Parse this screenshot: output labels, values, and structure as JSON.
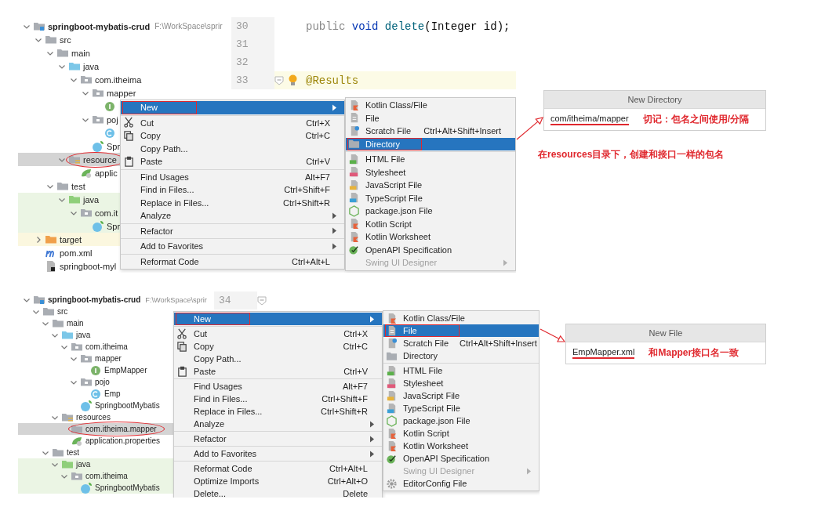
{
  "panels": [
    {
      "tree": {
        "nodes": [
          {
            "label": "springboot-mybatis-crud",
            "path": "F:\\WorkSpace\\sprir",
            "kind": "module",
            "expanded": true,
            "selected": false,
            "children": [
              {
                "label": "src",
                "kind": "folder",
                "expanded": true,
                "selected": false,
                "children": [
                  {
                    "label": "main",
                    "kind": "folder",
                    "expanded": true,
                    "selected": false,
                    "children": [
                      {
                        "label": "java",
                        "kind": "source",
                        "expanded": true,
                        "selected": false,
                        "children": [
                          {
                            "label": "com.itheima",
                            "kind": "package",
                            "expanded": true,
                            "selected": false,
                            "children": [
                              {
                                "label": "mapper",
                                "kind": "package",
                                "expanded": true,
                                "selected": false,
                                "children": [
                                  {
                                    "kind": "interface",
                                    "selected": false
                                  }
                                ]
                              },
                              {
                                "label": "poj",
                                "kind": "package",
                                "expanded": true,
                                "selected": false,
                                "children": [
                                  {
                                    "kind": "class",
                                    "selected": false
                                  }
                                ]
                              },
                              {
                                "label": "Spr",
                                "kind": "springclass",
                                "selected": false
                              }
                            ]
                          }
                        ]
                      },
                      {
                        "label": "resource",
                        "kind": "resources",
                        "expanded": true,
                        "selected": true,
                        "circled": true,
                        "children": [
                          {
                            "label": "applic",
                            "kind": "props",
                            "selected": false
                          }
                        ]
                      }
                    ]
                  },
                  {
                    "label": "test",
                    "kind": "folder",
                    "expanded": true,
                    "selected": false,
                    "children": [
                      {
                        "label": "java",
                        "kind": "testsource",
                        "test": true,
                        "expanded": true,
                        "selected": false,
                        "children": [
                          {
                            "label": "com.it",
                            "kind": "package",
                            "expanded": true,
                            "selected": false,
                            "children": [
                              {
                                "label": "Spr",
                                "kind": "springclass",
                                "selected": false
                              }
                            ]
                          }
                        ]
                      }
                    ]
                  }
                ]
              },
              {
                "label": "target",
                "kind": "target",
                "excluded": true,
                "expanded": false,
                "selected": false
              },
              {
                "label": "pom.xml",
                "kind": "maven",
                "selected": false
              },
              {
                "label": "springboot-myl",
                "kind": "iml",
                "selected": false
              }
            ]
          }
        ]
      },
      "editor": {
        "lines": [
          {
            "number": "30",
            "current": false,
            "hint": false,
            "fold": false,
            "tokens": [
              {
                "text": "public ",
                "kind": "modifier"
              },
              {
                "text": "void ",
                "kind": "keyword"
              },
              {
                "text": "delete",
                "kind": "method"
              },
              {
                "text": "(Integer id);",
                "kind": "plain"
              }
            ]
          },
          {
            "number": "31",
            "current": false,
            "hint": false,
            "fold": false
          },
          {
            "number": "32",
            "current": false,
            "hint": false,
            "fold": false
          },
          {
            "number": "33",
            "current": true,
            "hint": true,
            "fold": true,
            "tokens": [
              {
                "text": "@Results",
                "kind": "annotation"
              }
            ]
          }
        ]
      },
      "menu": {
        "groups": [
          [
            {
              "label": "New",
              "submenu": true,
              "selected": true,
              "annotated": true
            }
          ],
          [
            {
              "label": "Cut",
              "shortcut": "Ctrl+X",
              "kind": "scissors",
              "selected": false
            },
            {
              "label": "Copy",
              "shortcut": "Ctrl+C",
              "kind": "copy",
              "selected": false
            },
            {
              "label": "Copy Path...",
              "selected": false
            },
            {
              "label": "Paste",
              "shortcut": "Ctrl+V",
              "kind": "paste",
              "selected": false
            }
          ],
          [
            {
              "label": "Find Usages",
              "shortcut": "Alt+F7",
              "selected": false
            },
            {
              "label": "Find in Files...",
              "shortcut": "Ctrl+Shift+F",
              "selected": false
            },
            {
              "label": "Replace in Files...",
              "shortcut": "Ctrl+Shift+R",
              "selected": false
            },
            {
              "label": "Analyze",
              "submenu": true,
              "selected": false
            }
          ],
          [
            {
              "label": "Refactor",
              "submenu": true,
              "selected": false
            }
          ],
          [
            {
              "label": "Add to Favorites",
              "submenu": true,
              "selected": false
            }
          ],
          [
            {
              "label": "Reformat Code",
              "shortcut": "Ctrl+Alt+L",
              "selected": false
            }
          ]
        ]
      },
      "submenu": {
        "groups": [
          [
            {
              "label": "Kotlin Class/File",
              "kind": "kotlin",
              "selected": false
            },
            {
              "label": "File",
              "kind": "file",
              "selected": false
            },
            {
              "label": "Scratch File",
              "shortcut": "Ctrl+Alt+Shift+Insert",
              "kind": "scratch",
              "selected": false
            },
            {
              "label": "Directory",
              "kind": "folder",
              "selected": true,
              "annotated": true
            }
          ],
          [
            {
              "label": "HTML File",
              "kind": "html",
              "selected": false
            },
            {
              "label": "Stylesheet",
              "kind": "css",
              "selected": false
            },
            {
              "label": "JavaScript File",
              "kind": "js",
              "selected": false
            },
            {
              "label": "TypeScript File",
              "kind": "ts",
              "selected": false
            },
            {
              "label": "package.json File",
              "kind": "nodejs",
              "selected": false
            },
            {
              "label": "Kotlin Script",
              "kind": "kotlin",
              "selected": false
            },
            {
              "label": "Kotlin Worksheet",
              "kind": "kotlin",
              "selected": false
            },
            {
              "label": "OpenAPI Specification",
              "kind": "openapi",
              "selected": false
            },
            {
              "label": "Swing UI Designer",
              "submenu": true,
              "disabled": true,
              "selected": false
            }
          ]
        ]
      },
      "dialog": {
        "title": "New Directory",
        "value": "com/itheima/mapper",
        "note": "切记：包名之间使用/分隔"
      },
      "caption": "在resources目录下，创建和接口一样的包名"
    },
    {
      "tree": {
        "nodes": [
          {
            "label": "springboot-mybatis-crud",
            "path": "F:\\WorkSpace\\sprir",
            "kind": "module",
            "expanded": true,
            "selected": false,
            "children": [
              {
                "label": "src",
                "kind": "folder",
                "expanded": true,
                "selected": false,
                "children": [
                  {
                    "label": "main",
                    "kind": "folder",
                    "expanded": true,
                    "selected": false,
                    "children": [
                      {
                        "label": "java",
                        "kind": "source",
                        "expanded": true,
                        "selected": false,
                        "children": [
                          {
                            "label": "com.itheima",
                            "kind": "package",
                            "expanded": true,
                            "selected": false,
                            "children": [
                              {
                                "label": "mapper",
                                "kind": "package",
                                "expanded": true,
                                "selected": false,
                                "children": [
                                  {
                                    "label": "EmpMapper",
                                    "kind": "interface",
                                    "selected": false
                                  }
                                ]
                              },
                              {
                                "label": "pojo",
                                "kind": "package",
                                "expanded": true,
                                "selected": false,
                                "children": [
                                  {
                                    "label": "Emp",
                                    "kind": "class",
                                    "selected": false
                                  }
                                ]
                              },
                              {
                                "label": "SpringbootMybatis",
                                "kind": "springclass",
                                "selected": false
                              }
                            ]
                          }
                        ]
                      },
                      {
                        "label": "resources",
                        "kind": "resources",
                        "expanded": true,
                        "selected": false,
                        "children": [
                          {
                            "label": "com.itheima.mapper",
                            "kind": "folder",
                            "selected": true,
                            "circled": true
                          },
                          {
                            "label": "application.properties",
                            "kind": "props",
                            "selected": false
                          }
                        ]
                      }
                    ]
                  },
                  {
                    "label": "test",
                    "kind": "folder",
                    "expanded": true,
                    "selected": false,
                    "children": [
                      {
                        "label": "java",
                        "kind": "testsource",
                        "test": true,
                        "expanded": true,
                        "selected": false,
                        "children": [
                          {
                            "label": "com.itheima",
                            "kind": "package",
                            "expanded": true,
                            "selected": false,
                            "children": [
                              {
                                "label": "SpringbootMybatis",
                                "kind": "springclass",
                                "selected": false
                              }
                            ]
                          }
                        ]
                      }
                    ]
                  }
                ]
              }
            ]
          }
        ]
      },
      "editor": {
        "lines": [
          {
            "number": "34",
            "current": false,
            "hint": false,
            "fold": true
          }
        ]
      },
      "menu": {
        "groups": [
          [
            {
              "label": "New",
              "submenu": true,
              "selected": true,
              "annotated": true
            }
          ],
          [
            {
              "label": "Cut",
              "shortcut": "Ctrl+X",
              "kind": "scissors",
              "selected": false
            },
            {
              "label": "Copy",
              "shortcut": "Ctrl+C",
              "kind": "copy",
              "selected": false
            },
            {
              "label": "Copy Path...",
              "selected": false
            },
            {
              "label": "Paste",
              "shortcut": "Ctrl+V",
              "kind": "paste",
              "selected": false
            }
          ],
          [
            {
              "label": "Find Usages",
              "shortcut": "Alt+F7",
              "selected": false
            },
            {
              "label": "Find in Files...",
              "shortcut": "Ctrl+Shift+F",
              "selected": false
            },
            {
              "label": "Replace in Files...",
              "shortcut": "Ctrl+Shift+R",
              "selected": false
            },
            {
              "label": "Analyze",
              "submenu": true,
              "selected": false
            }
          ],
          [
            {
              "label": "Refactor",
              "submenu": true,
              "selected": false
            }
          ],
          [
            {
              "label": "Add to Favorites",
              "submenu": true,
              "selected": false
            }
          ],
          [
            {
              "label": "Reformat Code",
              "shortcut": "Ctrl+Alt+L",
              "selected": false
            },
            {
              "label": "Optimize Imports",
              "shortcut": "Ctrl+Alt+O",
              "selected": false
            },
            {
              "label": "Delete...",
              "shortcut": "Delete",
              "selected": false
            }
          ]
        ]
      },
      "submenu": {
        "groups": [
          [
            {
              "label": "Kotlin Class/File",
              "kind": "kotlin",
              "selected": false
            },
            {
              "label": "File",
              "kind": "file",
              "selected": true,
              "annotated": true
            },
            {
              "label": "Scratch File",
              "shortcut": "Ctrl+Alt+Shift+Insert",
              "kind": "scratch",
              "selected": false
            },
            {
              "label": "Directory",
              "kind": "folder",
              "selected": false
            }
          ],
          [
            {
              "label": "HTML File",
              "kind": "html",
              "selected": false
            },
            {
              "label": "Stylesheet",
              "kind": "css",
              "selected": false
            },
            {
              "label": "JavaScript File",
              "kind": "js",
              "selected": false
            },
            {
              "label": "TypeScript File",
              "kind": "ts",
              "selected": false
            },
            {
              "label": "package.json File",
              "kind": "nodejs",
              "selected": false
            },
            {
              "label": "Kotlin Script",
              "kind": "kotlin",
              "selected": false
            },
            {
              "label": "Kotlin Worksheet",
              "kind": "kotlin",
              "selected": false
            },
            {
              "label": "OpenAPI Specification",
              "kind": "openapi",
              "selected": false
            },
            {
              "label": "Swing UI Designer",
              "submenu": true,
              "disabled": true,
              "selected": false
            },
            {
              "label": "EditorConfig File",
              "kind": "gear",
              "selected": false
            }
          ]
        ]
      },
      "dialog": {
        "title": "New File",
        "value": "EmpMapper.xml",
        "note": "和Mapper接口名一致"
      }
    }
  ]
}
